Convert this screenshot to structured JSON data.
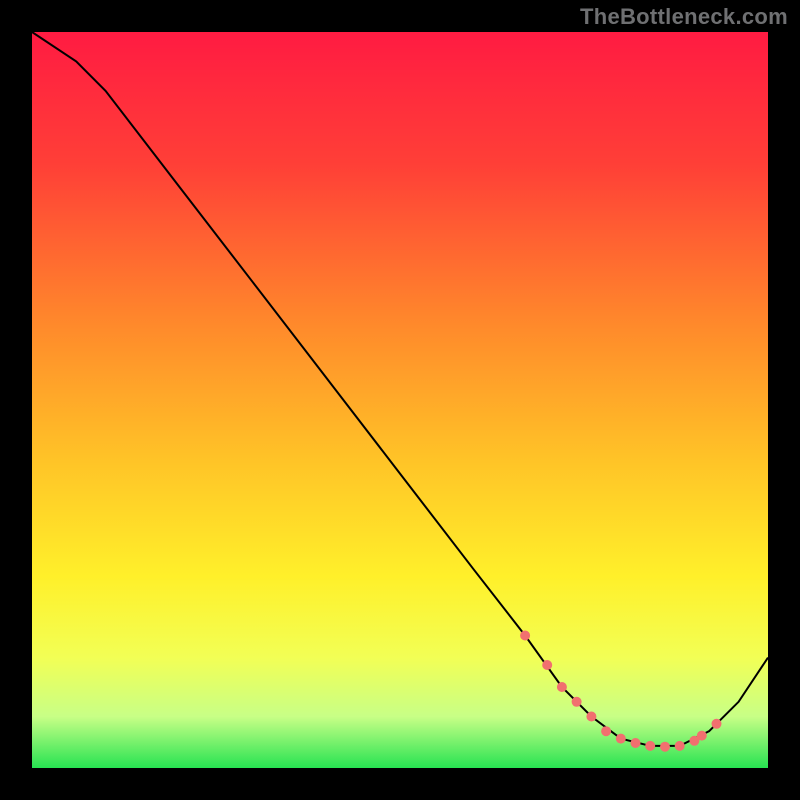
{
  "watermark": "TheBottleneck.com",
  "colors": {
    "curve": "#000000",
    "dots": "#f1706f",
    "gradient_stops": [
      {
        "offset": 0.0,
        "hex": "#ff1b42"
      },
      {
        "offset": 0.18,
        "hex": "#ff3f37"
      },
      {
        "offset": 0.4,
        "hex": "#ff8a2b"
      },
      {
        "offset": 0.58,
        "hex": "#ffc327"
      },
      {
        "offset": 0.74,
        "hex": "#fff02a"
      },
      {
        "offset": 0.85,
        "hex": "#f2ff55"
      },
      {
        "offset": 0.93,
        "hex": "#c8ff86"
      },
      {
        "offset": 1.0,
        "hex": "#27e352"
      }
    ]
  },
  "chart_data": {
    "type": "line",
    "title": "",
    "xlabel": "",
    "ylabel": "",
    "xlim": [
      0,
      100
    ],
    "ylim": [
      0,
      100
    ],
    "x": [
      0,
      6,
      10,
      20,
      30,
      40,
      50,
      60,
      67,
      72,
      76,
      80,
      84,
      88,
      92,
      96,
      100
    ],
    "y": [
      100,
      96,
      92,
      79,
      66,
      53,
      40,
      27,
      18,
      11,
      7,
      4,
      3,
      3,
      5,
      9,
      15
    ],
    "highlight_dots": {
      "x": [
        67,
        70,
        72,
        74,
        76,
        78,
        80,
        82,
        84,
        86,
        88,
        90,
        91,
        93
      ],
      "y": [
        18,
        14,
        11,
        9,
        7,
        5,
        4,
        3.4,
        3,
        2.9,
        3,
        3.7,
        4.4,
        6
      ]
    }
  }
}
